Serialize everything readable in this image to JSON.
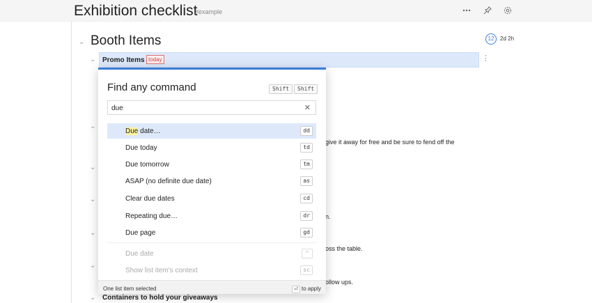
{
  "header": {
    "title": "Exhibition checklist",
    "tag": "#example",
    "icons": [
      "more-icon",
      "pin-icon",
      "settings-icon"
    ]
  },
  "section": {
    "title": "Booth Items",
    "count": "12",
    "time": "2d 2h"
  },
  "selected_item": {
    "title": "Promo Items",
    "due_tag": "today"
  },
  "background_text": [
    "give it away for free and be sure to fend off the",
    "n.",
    "oss the table.",
    "ollow ups."
  ],
  "next_item": {
    "title": "Containers to hold your giveaways"
  },
  "palette": {
    "title": "Find any command",
    "shortcut_keys": [
      "Shift",
      "Shift"
    ],
    "query": "due",
    "commands": [
      {
        "label_match": "Due",
        "label_rest": " date…",
        "key": "dd"
      },
      {
        "label": "Due today",
        "key": "td"
      },
      {
        "label": "Due tomorrow",
        "key": "tm"
      },
      {
        "label": "ASAP (no definite due date)",
        "key": "as"
      },
      {
        "label": "Clear due dates",
        "key": "cd"
      },
      {
        "label": "Repeating due…",
        "key": "dr"
      },
      {
        "label": "Due page",
        "key": "gd"
      }
    ],
    "recent_commands": [
      {
        "label": "Due date",
        "key": "^"
      },
      {
        "label": "Show list item's context",
        "key": "sc"
      }
    ],
    "footer_status": "One list item selected",
    "footer_enter_key": "⏎",
    "footer_action": "to apply"
  },
  "colors": {
    "accent": "#3b7dd8",
    "selection": "#dde9fb",
    "due_tag": "#d04040",
    "highlight": "#faf3a0"
  }
}
